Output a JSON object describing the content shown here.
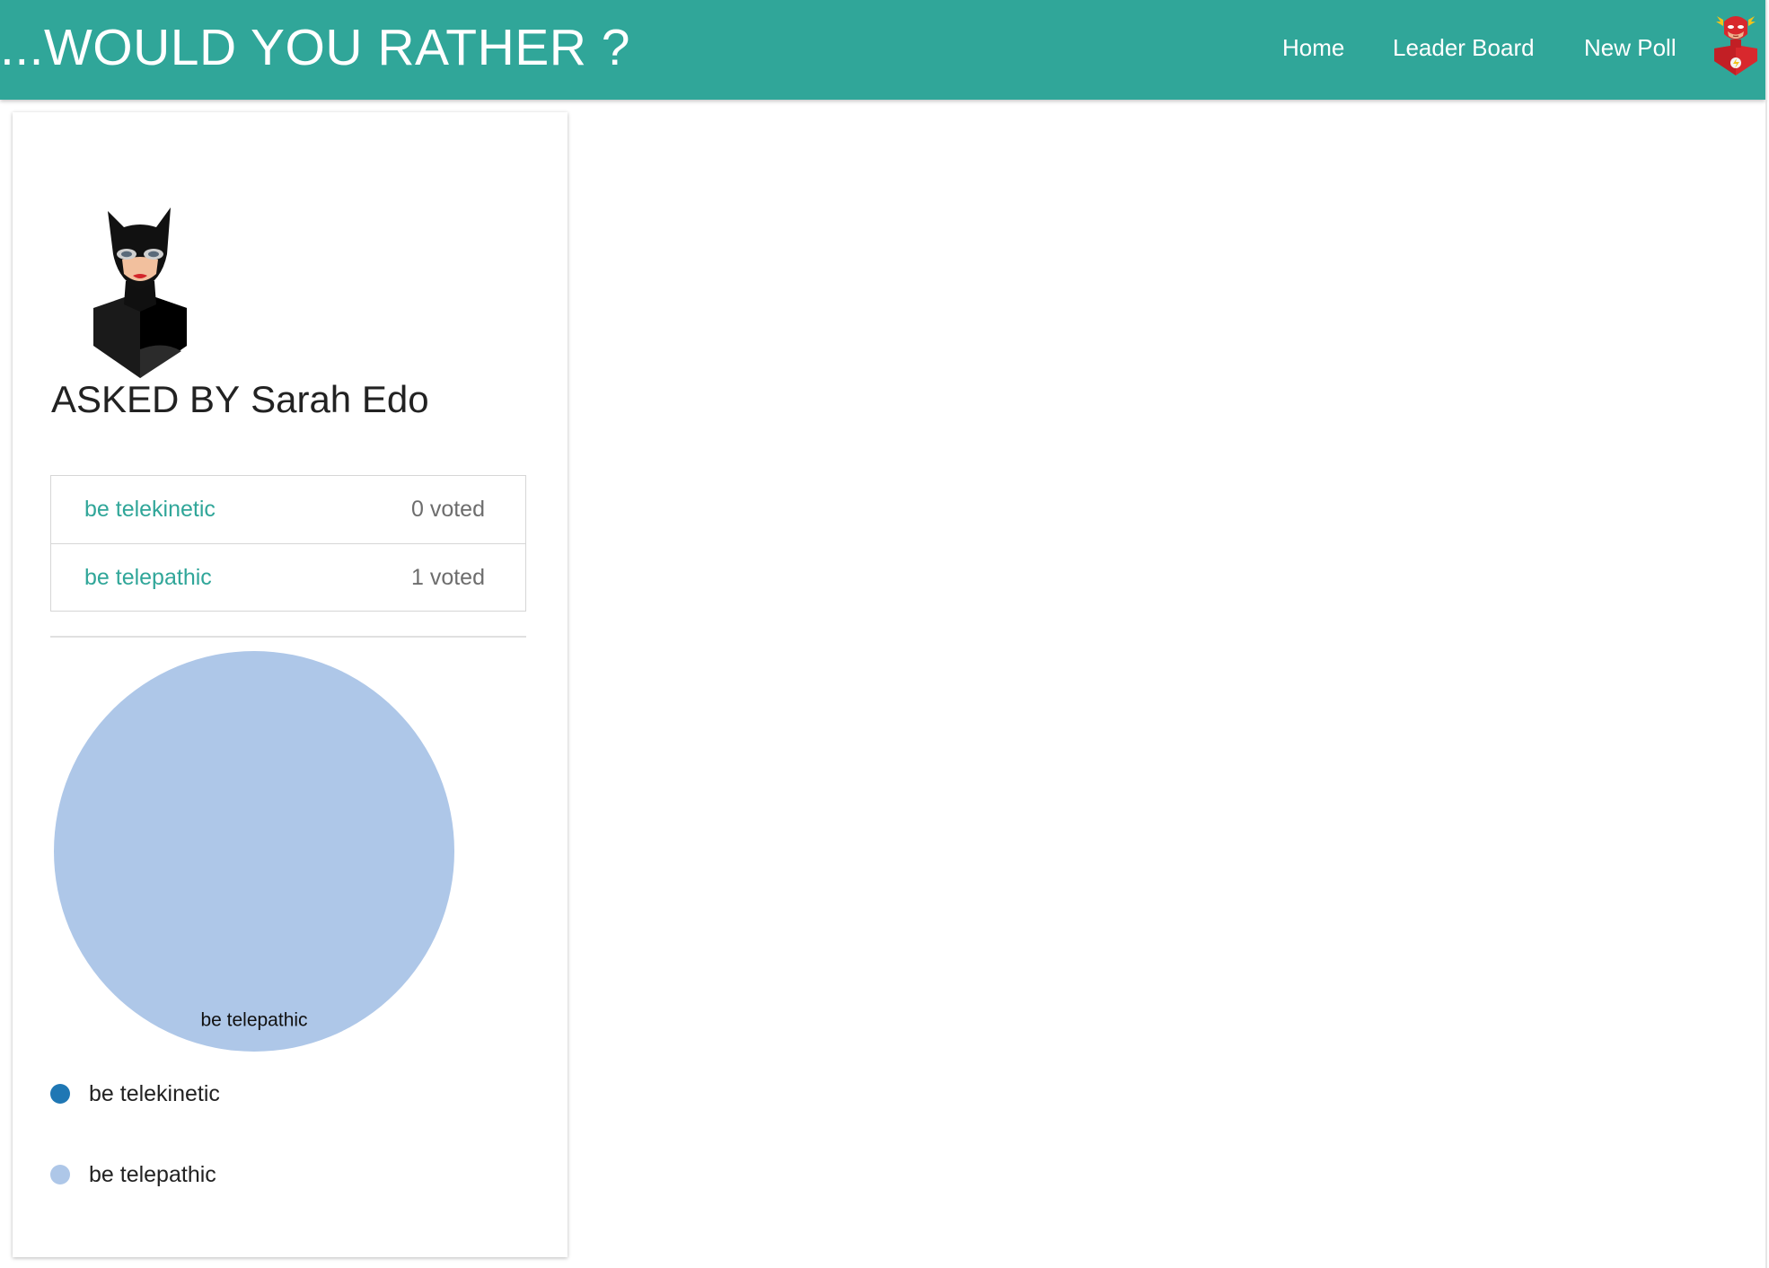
{
  "header": {
    "brand": "...WOULD YOU RATHER ?",
    "nav": [
      "Home",
      "Leader Board",
      "New Poll"
    ],
    "avatar_icon": "flash-hero-avatar-icon"
  },
  "question": {
    "asked_by_prefix": "ASKED BY",
    "author": "Sarah Edo",
    "author_avatar_icon": "catwoman-avatar-icon",
    "options": [
      {
        "text": "be telekinetic",
        "votes": "0 voted"
      },
      {
        "text": "be telepathic",
        "votes": "1 voted"
      }
    ]
  },
  "chart_data": {
    "type": "pie",
    "categories": [
      "be telekinetic",
      "be telepathic"
    ],
    "values": [
      0,
      1
    ],
    "colors": [
      "#1f77b4",
      "#aec7e8"
    ],
    "legend": [
      "be telekinetic",
      "be telepathic"
    ],
    "legend_position": "bottom-left"
  },
  "colors": {
    "accent": "#30a699",
    "pie_slice": "#aec7e8",
    "legend_dot_1": "#1f77b4",
    "legend_dot_2": "#aec7e8"
  }
}
